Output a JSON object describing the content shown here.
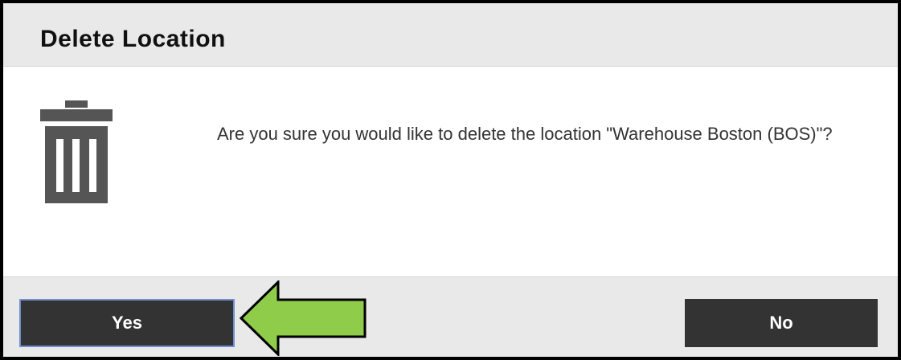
{
  "dialog": {
    "title": "Delete Location",
    "message": "Are you sure you would like to delete the location \"Warehouse Boston (BOS)\"?",
    "icon": "trash-icon"
  },
  "buttons": {
    "yes_label": "Yes",
    "no_label": "No"
  },
  "annotation": {
    "icon": "arrow-left-icon",
    "color": "#8ecc4a"
  },
  "colors": {
    "header_bg": "#e9e9e9",
    "button_bg": "#333333",
    "button_text": "#ffffff",
    "focus_border": "#6f8fd0"
  }
}
